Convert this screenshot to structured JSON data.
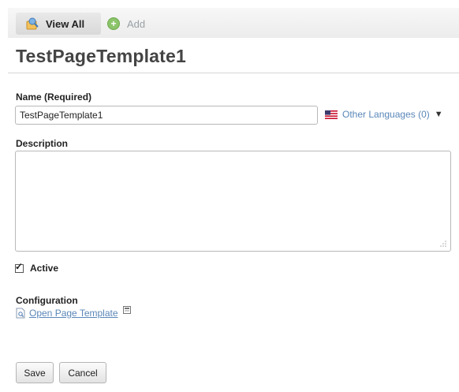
{
  "toolbar": {
    "view_all_label": "View All",
    "add_label": "Add",
    "view_all_icon": "view-all-icon",
    "add_icon": "plus-circle-icon"
  },
  "page": {
    "title": "TestPageTemplate1"
  },
  "form": {
    "name_label": "Name (Required)",
    "name_value": "TestPageTemplate1",
    "other_languages_label": "Other Languages (0)",
    "flag_icon": "us-flag-icon",
    "description_label": "Description",
    "description_value": "",
    "active_label": "Active",
    "active_checked": true,
    "configuration_label": "Configuration",
    "open_page_template_label": "Open Page Template"
  },
  "actions": {
    "save_label": "Save",
    "cancel_label": "Cancel"
  },
  "colors": {
    "link": "#5a87b8",
    "title": "#444444",
    "add_disabled": "#9aa0a6",
    "plus_green": "#8bc46a"
  }
}
